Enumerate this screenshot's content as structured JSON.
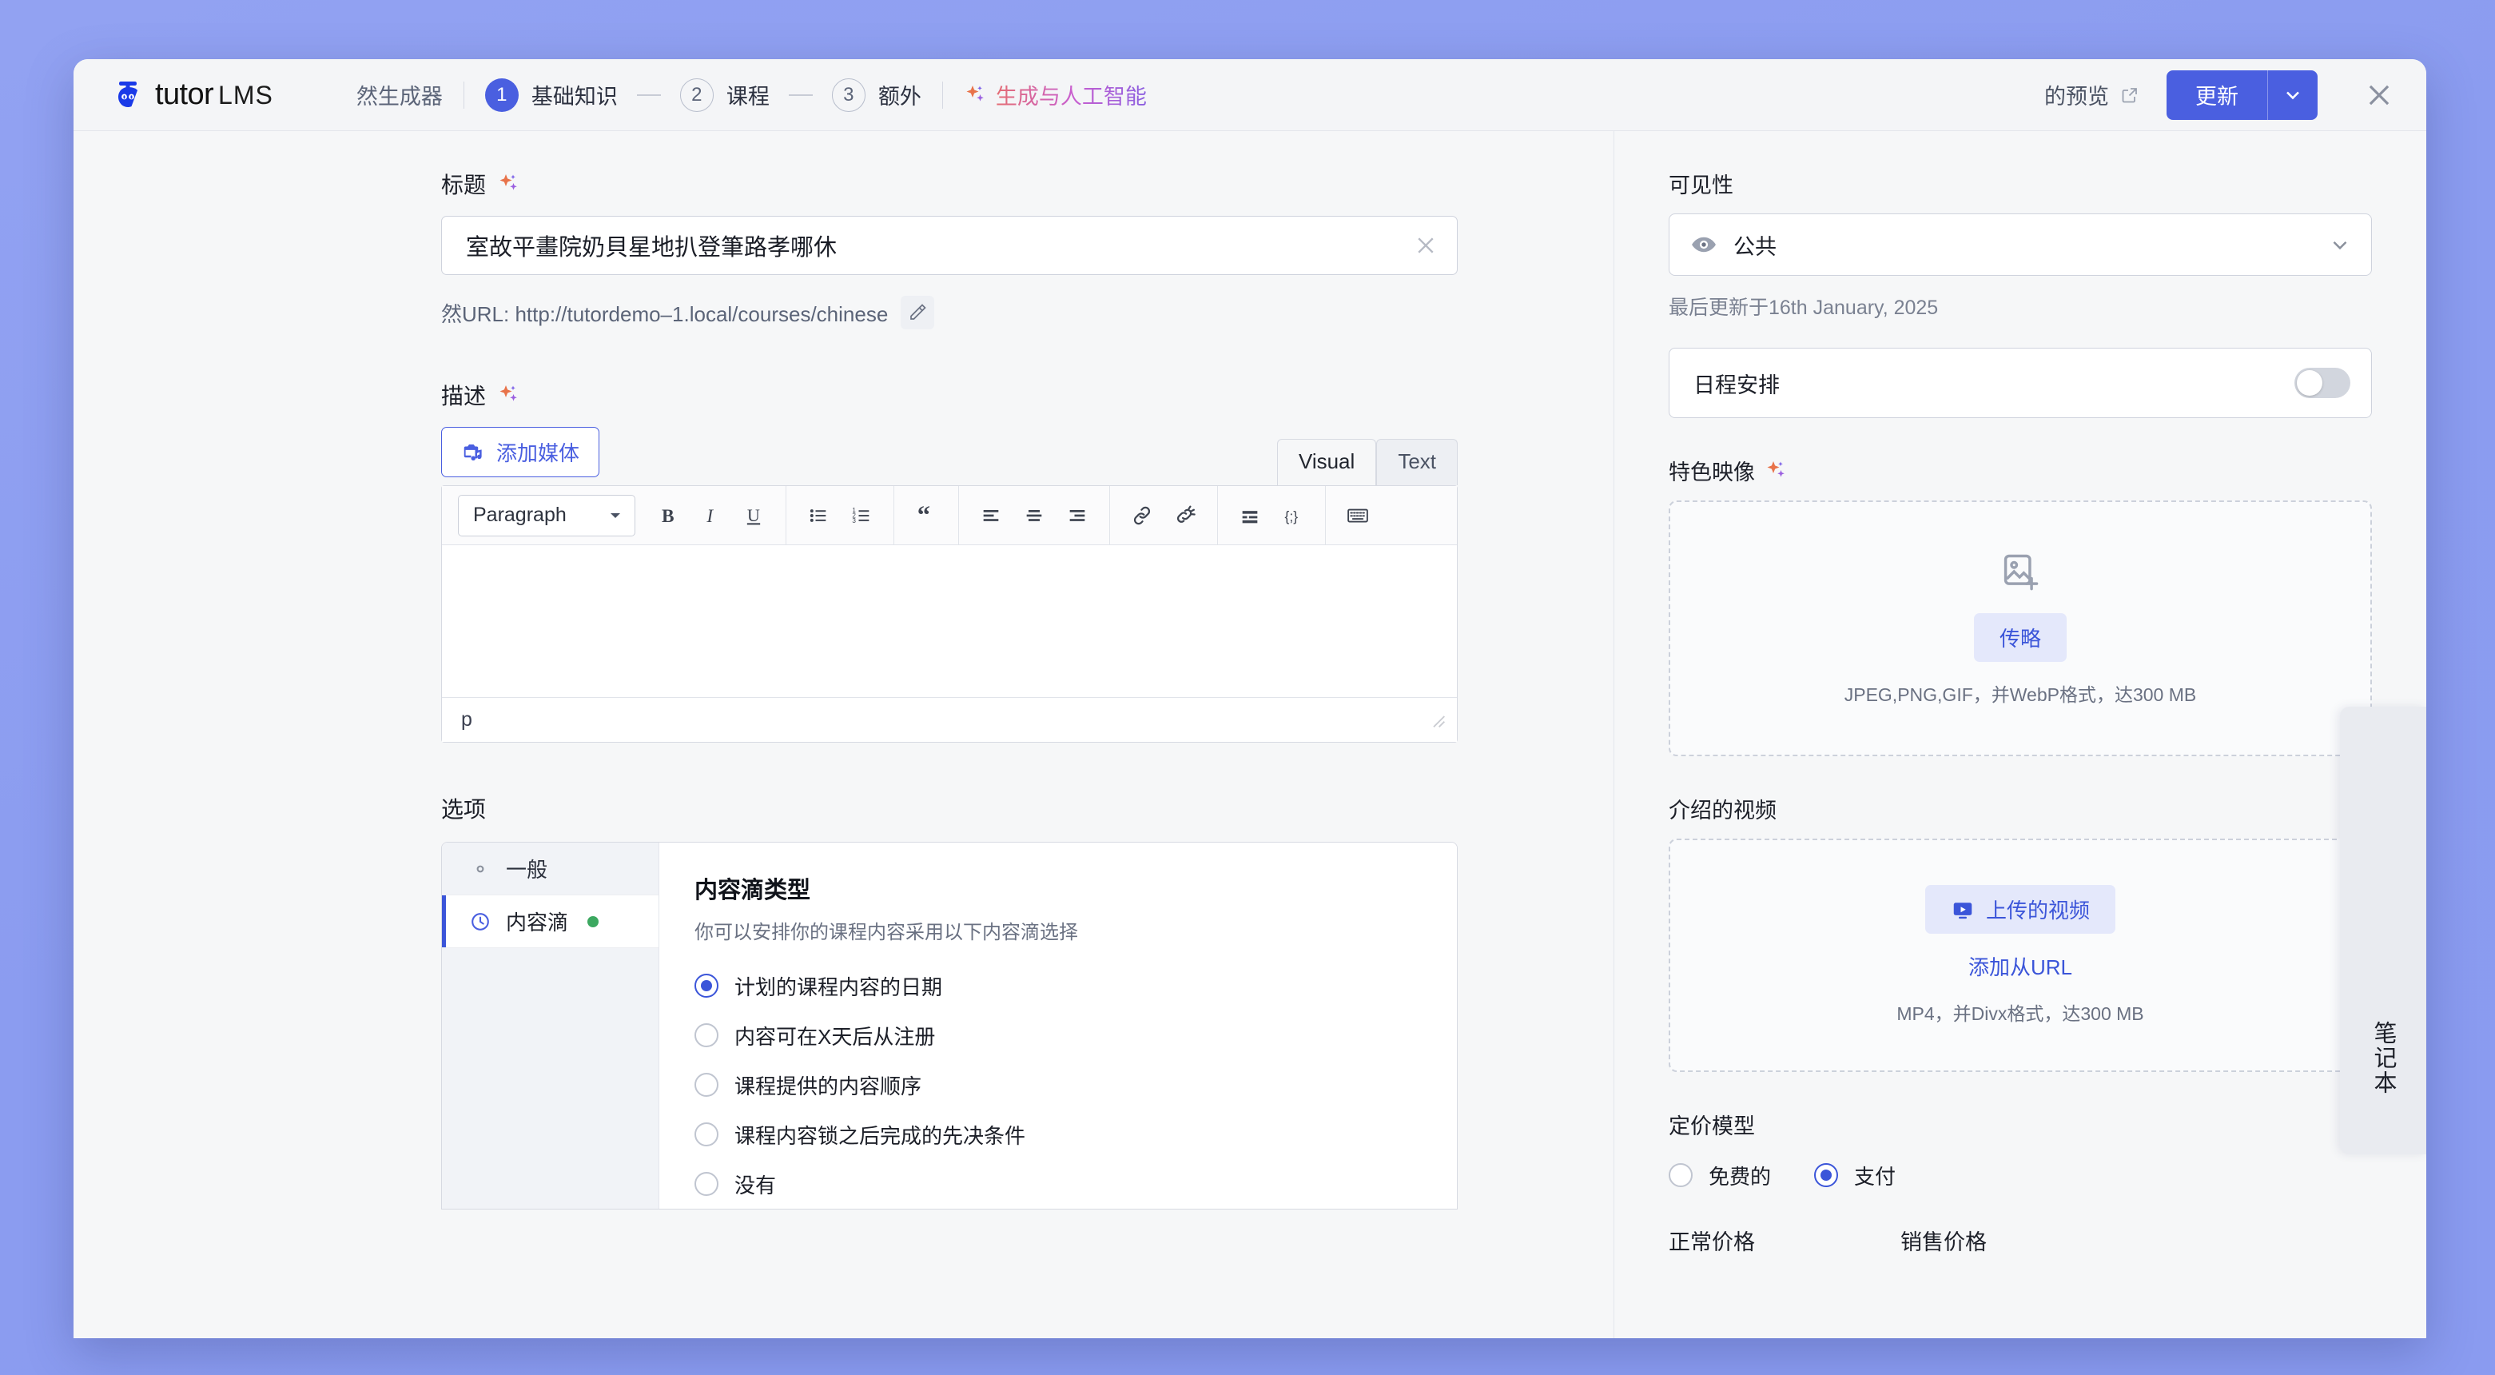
{
  "header": {
    "brand_name": "tutor",
    "brand_suffix": "LMS",
    "generator_label": "然生成器",
    "steps": [
      {
        "num": "1",
        "label": "基础知识",
        "active": true
      },
      {
        "num": "2",
        "label": "课程",
        "active": false
      },
      {
        "num": "3",
        "label": "额外",
        "active": false
      }
    ],
    "ai_label": "生成与人工智能",
    "preview_label": "的预览",
    "update_label": "更新"
  },
  "left": {
    "title_label": "标题",
    "title_value": "室故平畫院奶貝星地扒登筆路孝哪休",
    "url_text": "然URL: http://tutordemo–1.local/courses/chinese",
    "description_label": "描述",
    "add_media_label": "添加媒体",
    "tab_visual": "Visual",
    "tab_text": "Text",
    "paragraph_label": "Paragraph",
    "editor_status": "p",
    "options_label": "选项",
    "opt_nav": [
      {
        "label": "一般",
        "icon": "gear-icon",
        "active": false,
        "dot": false
      },
      {
        "label": "内容滴",
        "icon": "clock-icon",
        "active": true,
        "dot": true
      }
    ],
    "drip_title": "内容滴类型",
    "drip_sub": "你可以安排你的课程内容采用以下内容滴选择",
    "drip_options": [
      {
        "label": "计划的课程内容的日期",
        "selected": true
      },
      {
        "label": "内容可在X天后从注册",
        "selected": false
      },
      {
        "label": "课程提供的内容顺序",
        "selected": false
      },
      {
        "label": "课程内容锁之后完成的先决条件",
        "selected": false
      },
      {
        "label": "没有",
        "selected": false
      }
    ]
  },
  "right": {
    "visibility_label": "可见性",
    "visibility_value": "公共",
    "last_updated": "最后更新于16th January, 2025",
    "schedule_label": "日程安排",
    "featured_label": "特色映像",
    "featured_upload_btn": "传略",
    "featured_hint": "JPEG,PNG,GIF，并WebP格式，达300 MB",
    "video_label": "介绍的视频",
    "video_upload_btn": "上传的视频",
    "video_url_link": "添加从URL",
    "video_hint": "MP4，并Divx格式，达300 MB",
    "pricing_label": "定价模型",
    "pricing_free": "免费的",
    "pricing_paid": "支付",
    "regular_price_label": "正常价格",
    "sale_price_label": "销售价格"
  },
  "side_tab": {
    "label": "笔记本"
  },
  "colors": {
    "accent": "#4a5fe0",
    "accent_dark": "#3b55d9",
    "page_bg": "#8b9cf0",
    "status_green": "#3ca860"
  }
}
